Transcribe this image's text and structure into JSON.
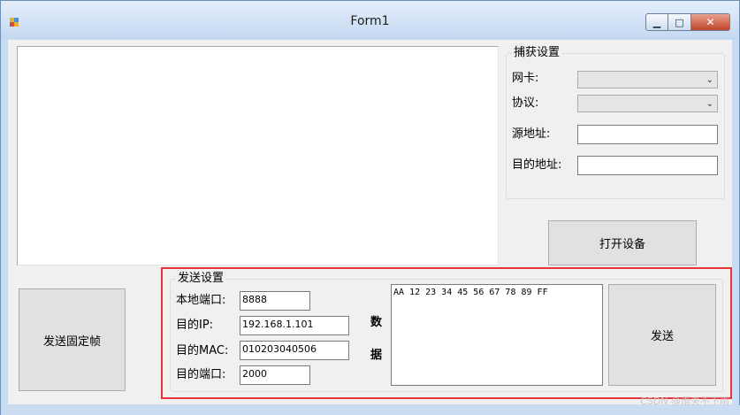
{
  "window": {
    "title": "Form1",
    "controls": {
      "minimize": "▁",
      "maximize": "□",
      "close": "✕"
    },
    "icon": "winforms-app-icon"
  },
  "capture": {
    "group_title": "捕获设置",
    "nic_label": "网卡:",
    "protocol_label": "协议:",
    "src_label": "源地址:",
    "dst_label": "目的地址:",
    "nic_value": "",
    "protocol_value": "",
    "src_value": "",
    "dst_value": "",
    "open_button": "打开设备"
  },
  "send": {
    "group_title": "发送设置",
    "fixed_frame_button": "发送固定帧",
    "local_port_label": "本地端口:",
    "dst_ip_label": "目的IP:",
    "dst_mac_label": "目的MAC:",
    "dst_port_label": "目的端口:",
    "local_port": "8888",
    "dst_ip": "192.168.1.101",
    "dst_mac": "010203040506",
    "dst_port": "2000",
    "data_label_1": "数",
    "data_label_2": "据",
    "data": "AA 12 23 34 45 56 67 78 89 FF",
    "send_button": "发送"
  },
  "watermark": "CSDN @雨夫不下雨",
  "colors": {
    "highlight": "#e8333a",
    "client_bg": "#f0f0f0",
    "frame": "#c9dcf2"
  }
}
